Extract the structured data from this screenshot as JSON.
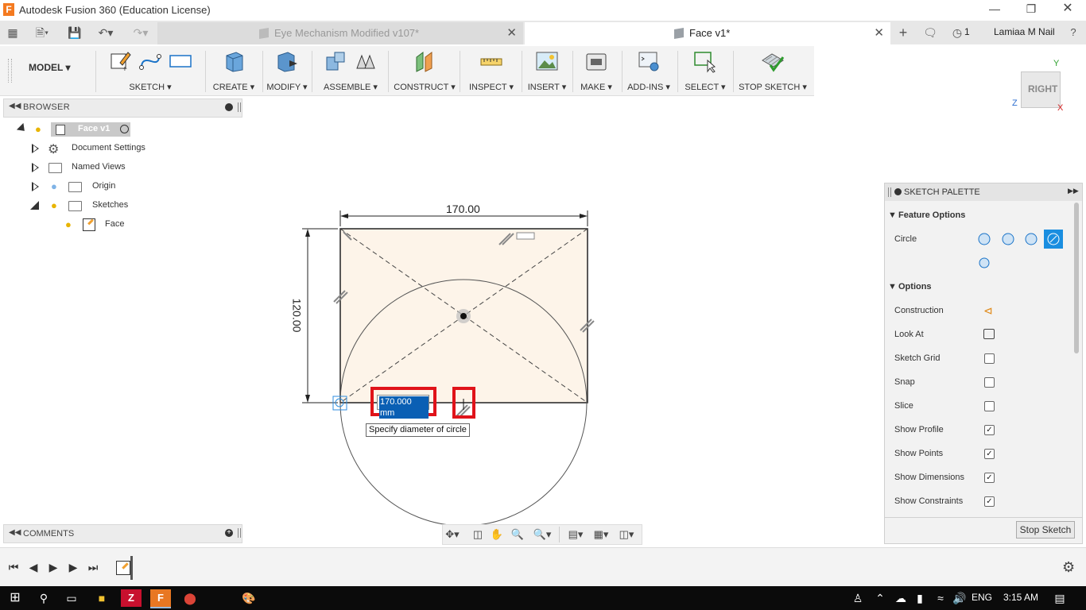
{
  "window": {
    "title": "Autodesk Fusion 360 (Education License)",
    "app_icon_letter": "F"
  },
  "tabs": [
    {
      "label": "Eye Mechanism Modified v107*",
      "active": false
    },
    {
      "label": "Face v1*",
      "active": true
    }
  ],
  "top_right": {
    "job_count": "1",
    "user": "Lamiaa M Nail"
  },
  "toolbar": {
    "workspace": "MODEL",
    "groups": [
      "SKETCH",
      "CREATE",
      "MODIFY",
      "ASSEMBLE",
      "CONSTRUCT",
      "INSPECT",
      "INSERT",
      "MAKE",
      "ADD-INS",
      "SELECT",
      "STOP SKETCH"
    ]
  },
  "browser": {
    "title": "BROWSER",
    "root": "Face v1",
    "items": [
      "Document Settings",
      "Named Views",
      "Origin",
      "Sketches",
      "Face"
    ]
  },
  "comments": {
    "title": "COMMENTS"
  },
  "canvas": {
    "dim_width": "170.00",
    "dim_height": "120.00",
    "input_value": "170.000 mm",
    "tooltip": "Specify diameter of circle"
  },
  "viewcube": {
    "face": "RIGHT",
    "axis_y": "Y",
    "axis_z": "Z",
    "axis_x": "X"
  },
  "palette": {
    "title": "SKETCH PALETTE",
    "feature_options": "Feature Options",
    "circle_label": "Circle",
    "options_title": "Options",
    "options": [
      {
        "label": "Construction",
        "type": "icon"
      },
      {
        "label": "Look At",
        "type": "icon"
      },
      {
        "label": "Sketch Grid",
        "type": "check",
        "checked": false
      },
      {
        "label": "Snap",
        "type": "check",
        "checked": false
      },
      {
        "label": "Slice",
        "type": "check",
        "checked": false
      },
      {
        "label": "Show Profile",
        "type": "check",
        "checked": true
      },
      {
        "label": "Show Points",
        "type": "check",
        "checked": true
      },
      {
        "label": "Show Dimensions",
        "type": "check",
        "checked": true
      },
      {
        "label": "Show Constraints",
        "type": "check",
        "checked": true
      }
    ],
    "stop_button": "Stop Sketch"
  },
  "taskbar": {
    "lang": "ENG",
    "time": "3:15 AM"
  },
  "colors": {
    "accent": "#0a78d7",
    "highlight_red": "#e0131a",
    "sketch_fill": "#fdf4e9",
    "taskbar": "#0b0b0b"
  }
}
